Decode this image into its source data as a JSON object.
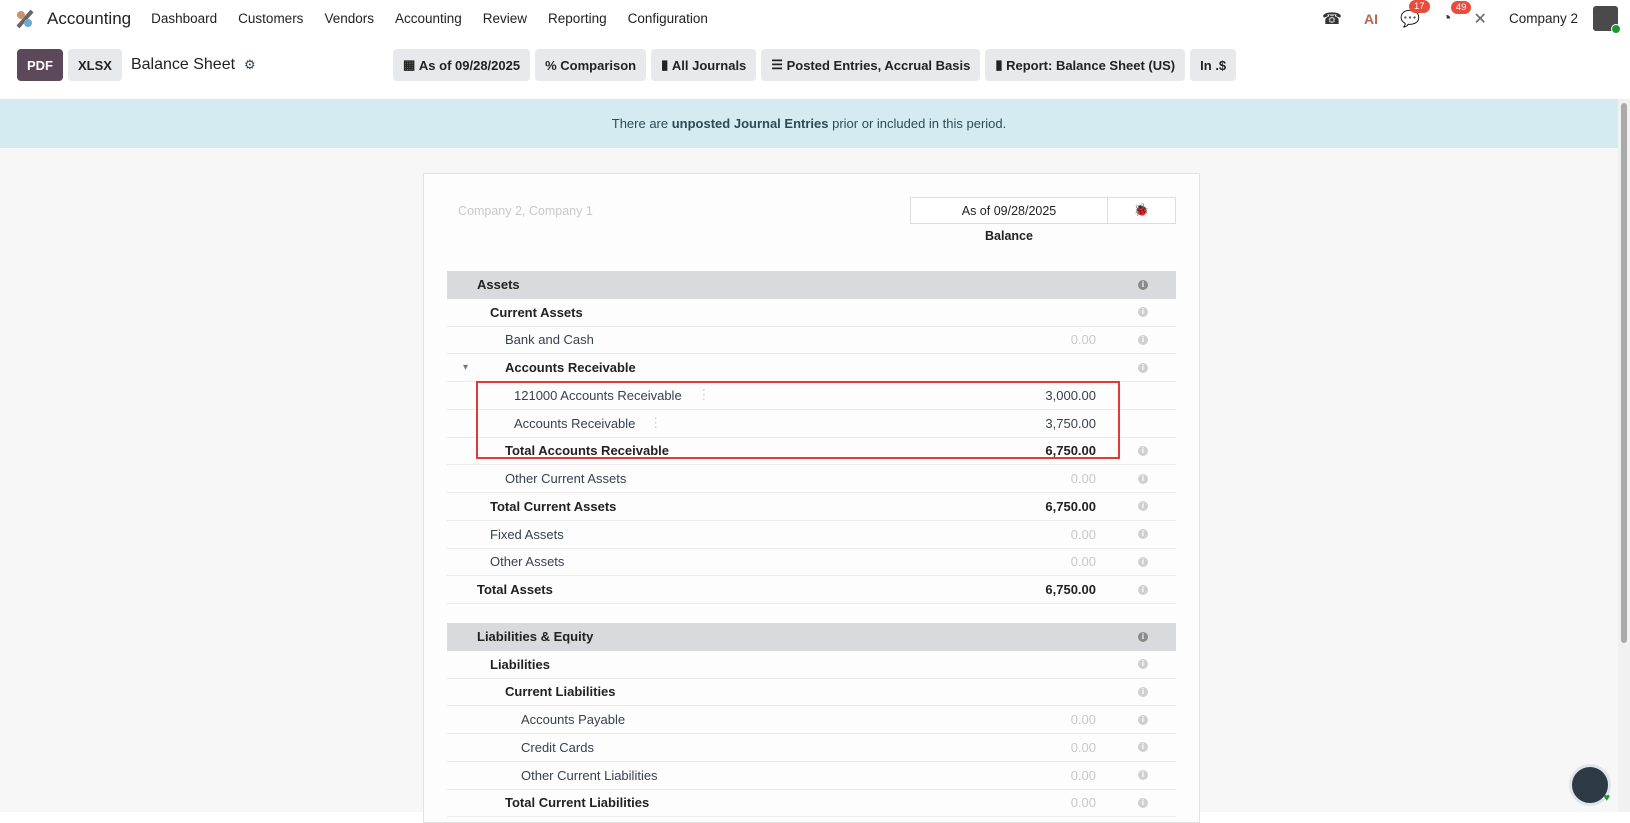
{
  "nav": {
    "app": "Accounting",
    "menu": [
      "Dashboard",
      "Customers",
      "Vendors",
      "Accounting",
      "Review",
      "Reporting",
      "Configuration"
    ],
    "chat_badge": "17",
    "activity_badge": "49",
    "ai": "AI",
    "company": "Company 2"
  },
  "control": {
    "pdf": "PDF",
    "xlsx": "XLSX",
    "title": "Balance Sheet",
    "filters": [
      "As of 09/28/2025",
      "Comparison",
      "All Journals",
      "Posted Entries, Accrual Basis",
      "Report: Balance Sheet (US)",
      "In .$"
    ]
  },
  "alert": {
    "pre": "There are ",
    "bold": "unposted Journal Entries",
    "post": " prior or included in this period."
  },
  "report": {
    "companies": "Company 2, Company 1",
    "date_header": "As of 09/28/2025",
    "column": "Balance",
    "rows": [
      {
        "label": "Assets",
        "amount": "",
        "level": 0,
        "type": "section"
      },
      {
        "label": "Current Assets",
        "amount": "",
        "level": 1,
        "type": "bold"
      },
      {
        "label": "Bank and Cash",
        "amount": "0.00",
        "level": 2,
        "type": "normal",
        "muted": true
      },
      {
        "label": "Accounts Receivable",
        "amount": "",
        "level": 2,
        "type": "bold",
        "caret": true
      },
      {
        "label": "121000 Accounts Receivable",
        "amount": "3,000.00",
        "level": "acct",
        "type": "account"
      },
      {
        "label": "Accounts Receivable",
        "amount": "3,750.00",
        "level": "acct",
        "type": "account"
      },
      {
        "label": "Total Accounts Receivable",
        "amount": "6,750.00",
        "level": 2,
        "type": "bold"
      },
      {
        "label": "Other Current Assets",
        "amount": "0.00",
        "level": 2,
        "type": "normal",
        "muted": true
      },
      {
        "label": "Total Current Assets",
        "amount": "6,750.00",
        "level": 1,
        "type": "bold"
      },
      {
        "label": "Fixed Assets",
        "amount": "0.00",
        "level": 1,
        "type": "normal",
        "muted": true
      },
      {
        "label": "Other Assets",
        "amount": "0.00",
        "level": 1,
        "type": "normal",
        "muted": true
      },
      {
        "label": "Total Assets",
        "amount": "6,750.00",
        "level": 0,
        "type": "bold"
      },
      {
        "type": "gap"
      },
      {
        "label": "Liabilities & Equity",
        "amount": "",
        "level": 0,
        "type": "section"
      },
      {
        "label": "Liabilities",
        "amount": "",
        "level": 1,
        "type": "bold"
      },
      {
        "label": "Current Liabilities",
        "amount": "",
        "level": 2,
        "type": "bold"
      },
      {
        "label": "Accounts Payable",
        "amount": "0.00",
        "level": 3,
        "type": "normal",
        "muted": true
      },
      {
        "label": "Credit Cards",
        "amount": "0.00",
        "level": 3,
        "type": "normal",
        "muted": true
      },
      {
        "label": "Other Current Liabilities",
        "amount": "0.00",
        "level": 3,
        "type": "normal",
        "muted": true
      },
      {
        "label": "Total Current Liabilities",
        "amount": "0.00",
        "level": 2,
        "type": "bold",
        "muted": true
      }
    ]
  }
}
